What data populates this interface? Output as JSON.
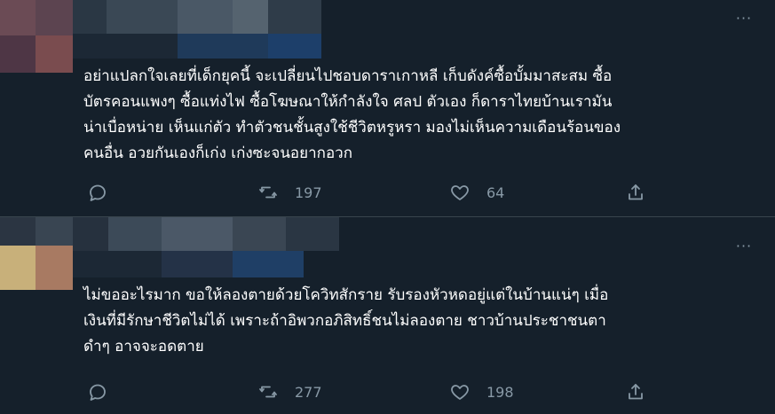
{
  "tweets": [
    {
      "more": "···",
      "text": "อย่าแปลกใจเลยที่เด็กยุคนี้ จะเปลี่ยนไปชอบดาราเกาหลี เก็บดังค์ซื้อบั้มมาสะสม ซื้อ\nบัตรคอนแพงๆ ซื้อแท่งไฟ ซื้อโฆษณาให้กำลังใจ ศลป ตัวเอง ก็ดาราไทยบ้านเรามัน\nน่าเบื่อหน่าย เห็นแก่ตัว ทำตัวชนชั้นสูงใช้ชีวิตหรูหรา มองไม่เห็นความเดือนร้อนของ\nคนอื่น อวยกันเองก็เก่ง เก่งซะจนอยากอวก",
      "actions": {
        "reply_count": "",
        "retweet_count": "197",
        "like_count": "64"
      }
    },
    {
      "more": "···",
      "text": "ไม่ขออะไรมาก ขอให้ลองตายด้วยโควิทสักราย รับรองหัวหดอยู่แต่ในบ้านแน่ๆ เมื่อ\nเงินที่มีรักษาชีวิตไม่ได้ เพราะถ้าอิพวกอภิสิทธิ์ชนไม่ลองตาย ชาวบ้านประชาชนตา\nดำๆ อาจจะอดตาย",
      "actions": {
        "reply_count": "",
        "retweet_count": "277",
        "like_count": "198"
      }
    }
  ],
  "icons": {
    "reply": "reply-icon",
    "retweet": "retweet-icon",
    "like": "heart-icon",
    "share": "share-icon"
  },
  "colors": {
    "background": "#15202b",
    "text": "#ffffff",
    "muted": "#8899a6",
    "divider": "#38444d"
  }
}
